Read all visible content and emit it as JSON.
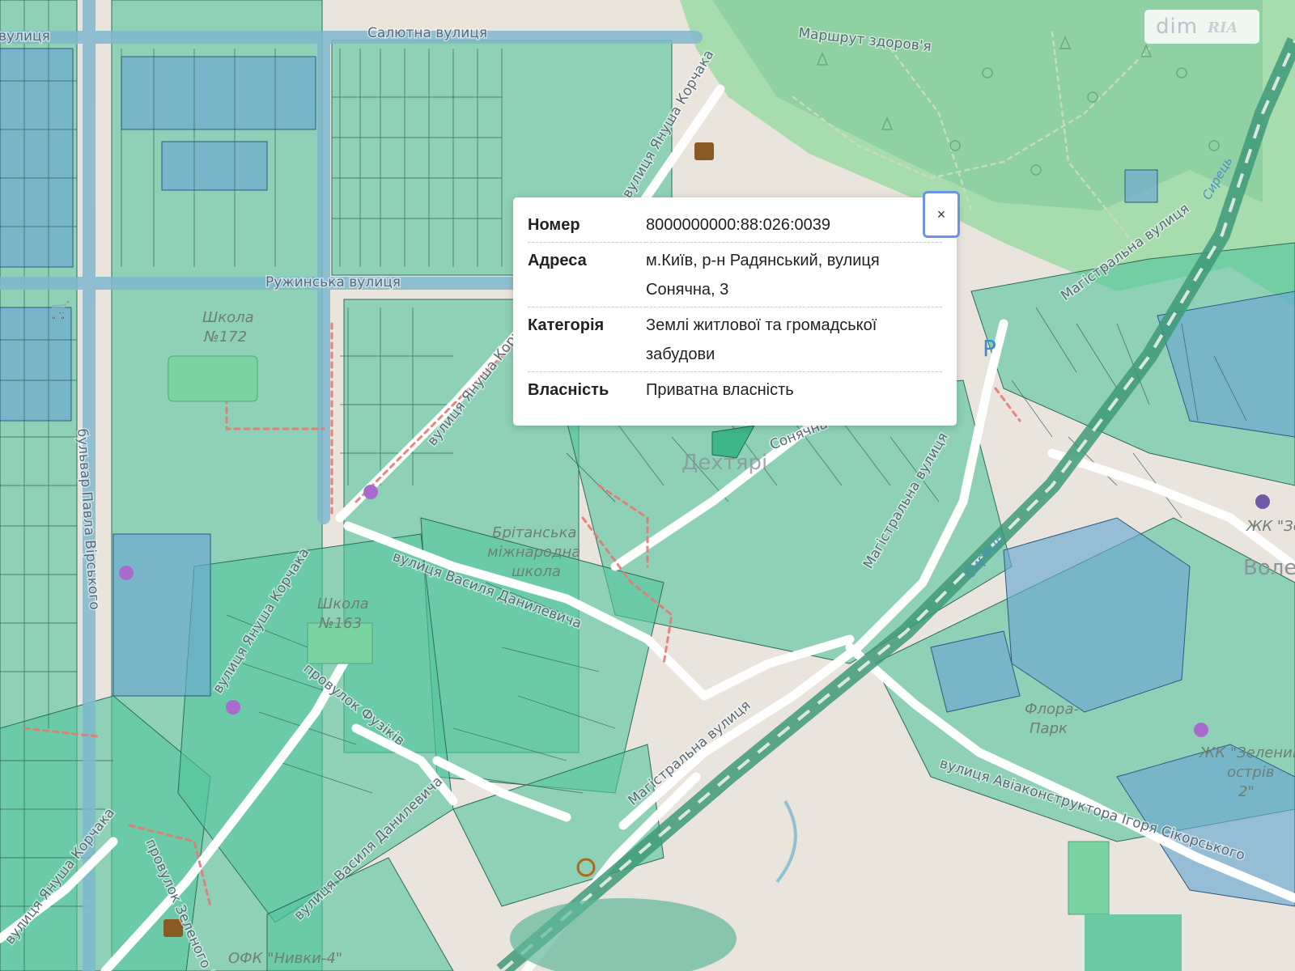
{
  "map": {
    "streets": {
      "salyutna": "Салютна вулиця",
      "salyutna_left": "вулиця",
      "ruzhynska": "Ружинська вулиця",
      "korchaka_top": "вулиця Януша Корчака",
      "korchaka_mid": "вулиця Януша Корча",
      "korchaka_left": "вулиця Януша Корчака",
      "korchaka_bottom": "вулиця Януша Корчака",
      "virskoho": "бульвар Павла Вірського",
      "danylevycha": "вулиця Василя Данилевича",
      "danylevycha_bottom": "вулиця Василя Данилевича",
      "fuzikiv": "провулок Фузіків",
      "zelenoho": "провулок Зеленого Клина",
      "mahistralna_1": "Магістральна вулиця",
      "mahistralna_2": "Магістральна вулиця",
      "mahistralna_3": "Магістральна вулиця",
      "sonyachna": "Сонячна",
      "sikorskoho": "вулиця Авіаконструктора Ігоря Сікорського",
      "marshrut": "Маршрут здоров'я",
      "syrets": "Сирець",
      "syrets_top": "Сирець",
      "dekhtyari": "Дехтярі"
    },
    "pois": {
      "school172_a": "Школа",
      "school172_b": "№172",
      "school163_a": "Школа",
      "school163_b": "№163",
      "british_a": "Брітанська",
      "british_b": "міжнародна",
      "british_c": "школа",
      "flora_a": "Флора-",
      "flora_b": "Парк",
      "zk_a": "ЖК \"Зелений",
      "zk_b": "острів",
      "zk_c": "2\"",
      "zk_right": "ЖК \"Зе",
      "vole": "Воле",
      "ofk": "ОФК \"Нивки-4\"",
      "parking": "P"
    }
  },
  "popup": {
    "rows": [
      {
        "key": "Номер",
        "value": "8000000000:88:026:0039"
      },
      {
        "key": "Адреса",
        "value": "м.Київ, р-н Радянський, вулиця Сонячна, 3"
      },
      {
        "key": "Категорія",
        "value": "Землі житлової та громадської забудови"
      },
      {
        "key": "Власність",
        "value": "Приватна власність"
      }
    ],
    "close_label": "×"
  },
  "logo": {
    "text": "dim",
    "mark": "RIA"
  },
  "colors": {
    "parcel_green": "#4fc39c",
    "parcel_blue": "#6aa7d3",
    "forest": "#9fd9a8",
    "road": "#ffffff",
    "rail": "#3e9a78",
    "close_border": "#6c93e6"
  }
}
